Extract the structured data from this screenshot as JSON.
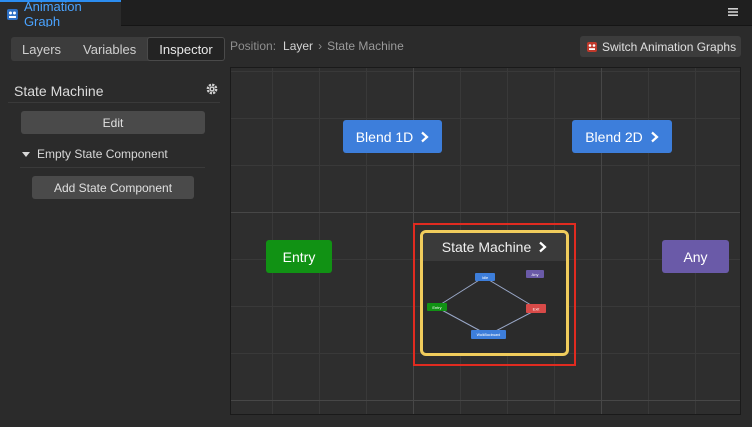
{
  "window": {
    "title": "Animation Graph"
  },
  "tabs": [
    {
      "label": "Layers"
    },
    {
      "label": "Variables"
    },
    {
      "label": "Inspector"
    }
  ],
  "inspector": {
    "title": "State Machine",
    "edit_label": "Edit",
    "component_label": "Empty State Component",
    "add_component_label": "Add State Component"
  },
  "position": {
    "prefix": "Position:",
    "crumb": "Layer",
    "separator": "›",
    "current": "State Machine"
  },
  "switch_button": {
    "label": "Switch Animation Graphs"
  },
  "nodes": {
    "blend1d": "Blend 1D",
    "blend2d": "Blend 2D",
    "entry": "Entry",
    "any": "Any",
    "state_machine": "State Machine"
  },
  "thumbnail": {
    "idle": "Idle",
    "any": "Any",
    "entry": "Entry",
    "exit": "Exit",
    "walk": "WalkBackward"
  },
  "colors": {
    "accent": "#2c8df0",
    "blend": "#3d7edb",
    "entry": "#119214",
    "any": "#6a5aa8",
    "exit": "#d84a48",
    "selection": "#e02b20",
    "highlight": "#f0cc5c"
  }
}
